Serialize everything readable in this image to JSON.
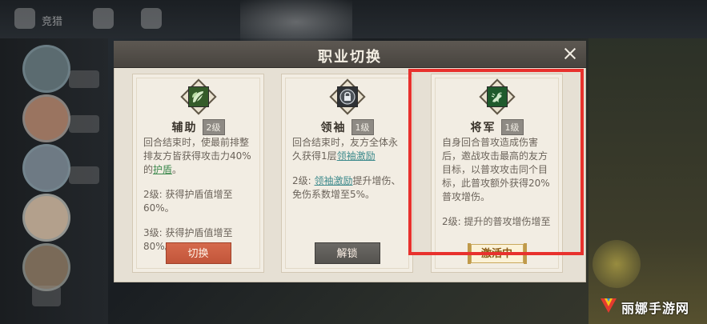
{
  "background": {
    "top_label": "竞猎"
  },
  "dialog": {
    "title": "职业切换",
    "close_icon": "close-icon"
  },
  "cards": [
    {
      "icon": "leaf-icon",
      "name": "辅助",
      "level": "2级",
      "desc_line1_prefix": "回合结束时，使最前排整排友方皆获得攻击力40%的",
      "desc_line1_link": "护盾",
      "desc_line1_suffix": "。",
      "desc_lvl2": "2级: 获得护盾值增至60%。",
      "desc_lvl3": "3级: 获得护盾值增至80%。",
      "button": "切换"
    },
    {
      "icon": "lock-icon",
      "name": "领袖",
      "level": "1级",
      "desc_line1_prefix": "回合结束时，友方全体永久获得1层",
      "desc_line1_link": "领袖激励",
      "desc_line1_suffix": "",
      "desc_lvl2_prefix": "2级: ",
      "desc_lvl2_link": "领袖激励",
      "desc_lvl2_suffix": "提升增伤、免伤系数增至5%。",
      "button": "解锁"
    },
    {
      "icon": "dragon-icon",
      "name": "将军",
      "level": "1级",
      "desc_line1": "自身回合普攻造成伤害后，邀战攻击最高的友方目标，以普攻攻击同个目标，此普攻额外获得20%普攻增伤。",
      "desc_lvl2": "2级: 提升的普攻增伤增至",
      "status": "激活中"
    }
  ],
  "watermark": {
    "text": "丽娜手游网"
  },
  "colors": {
    "highlight": "#e8312d",
    "switch_button": "#c95b3f",
    "unlock_button": "#5f5d59",
    "link_green": "#3f8a4f",
    "link_teal": "#3d8a8c"
  }
}
